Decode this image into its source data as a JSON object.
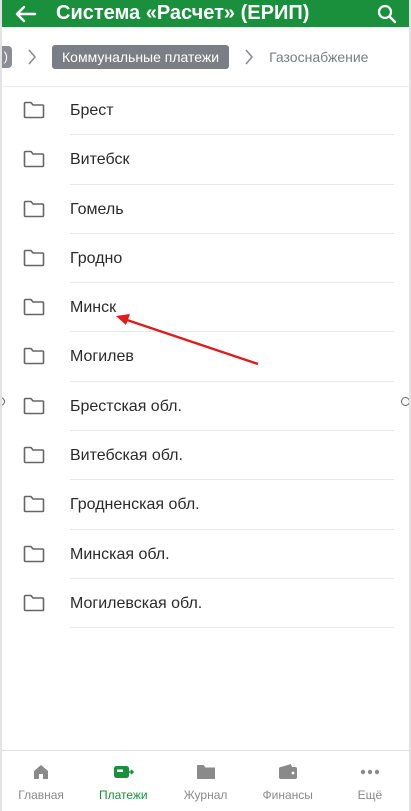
{
  "header": {
    "title": "Система «Расчет» (ЕРИП)",
    "accent_color": "#1a8f3c",
    "back_icon": "arrow-left-icon",
    "search_icon": "search-icon"
  },
  "breadcrumb": {
    "previous": ")",
    "active": "Коммунальные платежи",
    "next": "Газоснабжение"
  },
  "list": {
    "items": [
      {
        "label": "Брест",
        "icon": "folder-icon"
      },
      {
        "label": "Витебск",
        "icon": "folder-icon"
      },
      {
        "label": "Гомель",
        "icon": "folder-icon"
      },
      {
        "label": "Гродно",
        "icon": "folder-icon"
      },
      {
        "label": "Минск",
        "icon": "folder-icon"
      },
      {
        "label": "Могилев",
        "icon": "folder-icon"
      },
      {
        "label": "Брестская обл.",
        "icon": "folder-icon"
      },
      {
        "label": "Витебская обл.",
        "icon": "folder-icon"
      },
      {
        "label": "Гродненская обл.",
        "icon": "folder-icon"
      },
      {
        "label": "Минская обл.",
        "icon": "folder-icon"
      },
      {
        "label": "Могилевская обл.",
        "icon": "folder-icon"
      }
    ]
  },
  "annotation": {
    "color": "#e01b1b",
    "points_to": "Минск"
  },
  "bottom_nav": {
    "active_color": "#1a8f3c",
    "items": [
      {
        "label": "Главная",
        "icon": "home-icon",
        "active": false
      },
      {
        "label": "Платежи",
        "icon": "payments-icon",
        "active": true
      },
      {
        "label": "Журнал",
        "icon": "folder-icon",
        "active": false
      },
      {
        "label": "Финансы",
        "icon": "wallet-icon",
        "active": false
      },
      {
        "label": "Ещё",
        "icon": "more-icon",
        "active": false
      }
    ]
  }
}
